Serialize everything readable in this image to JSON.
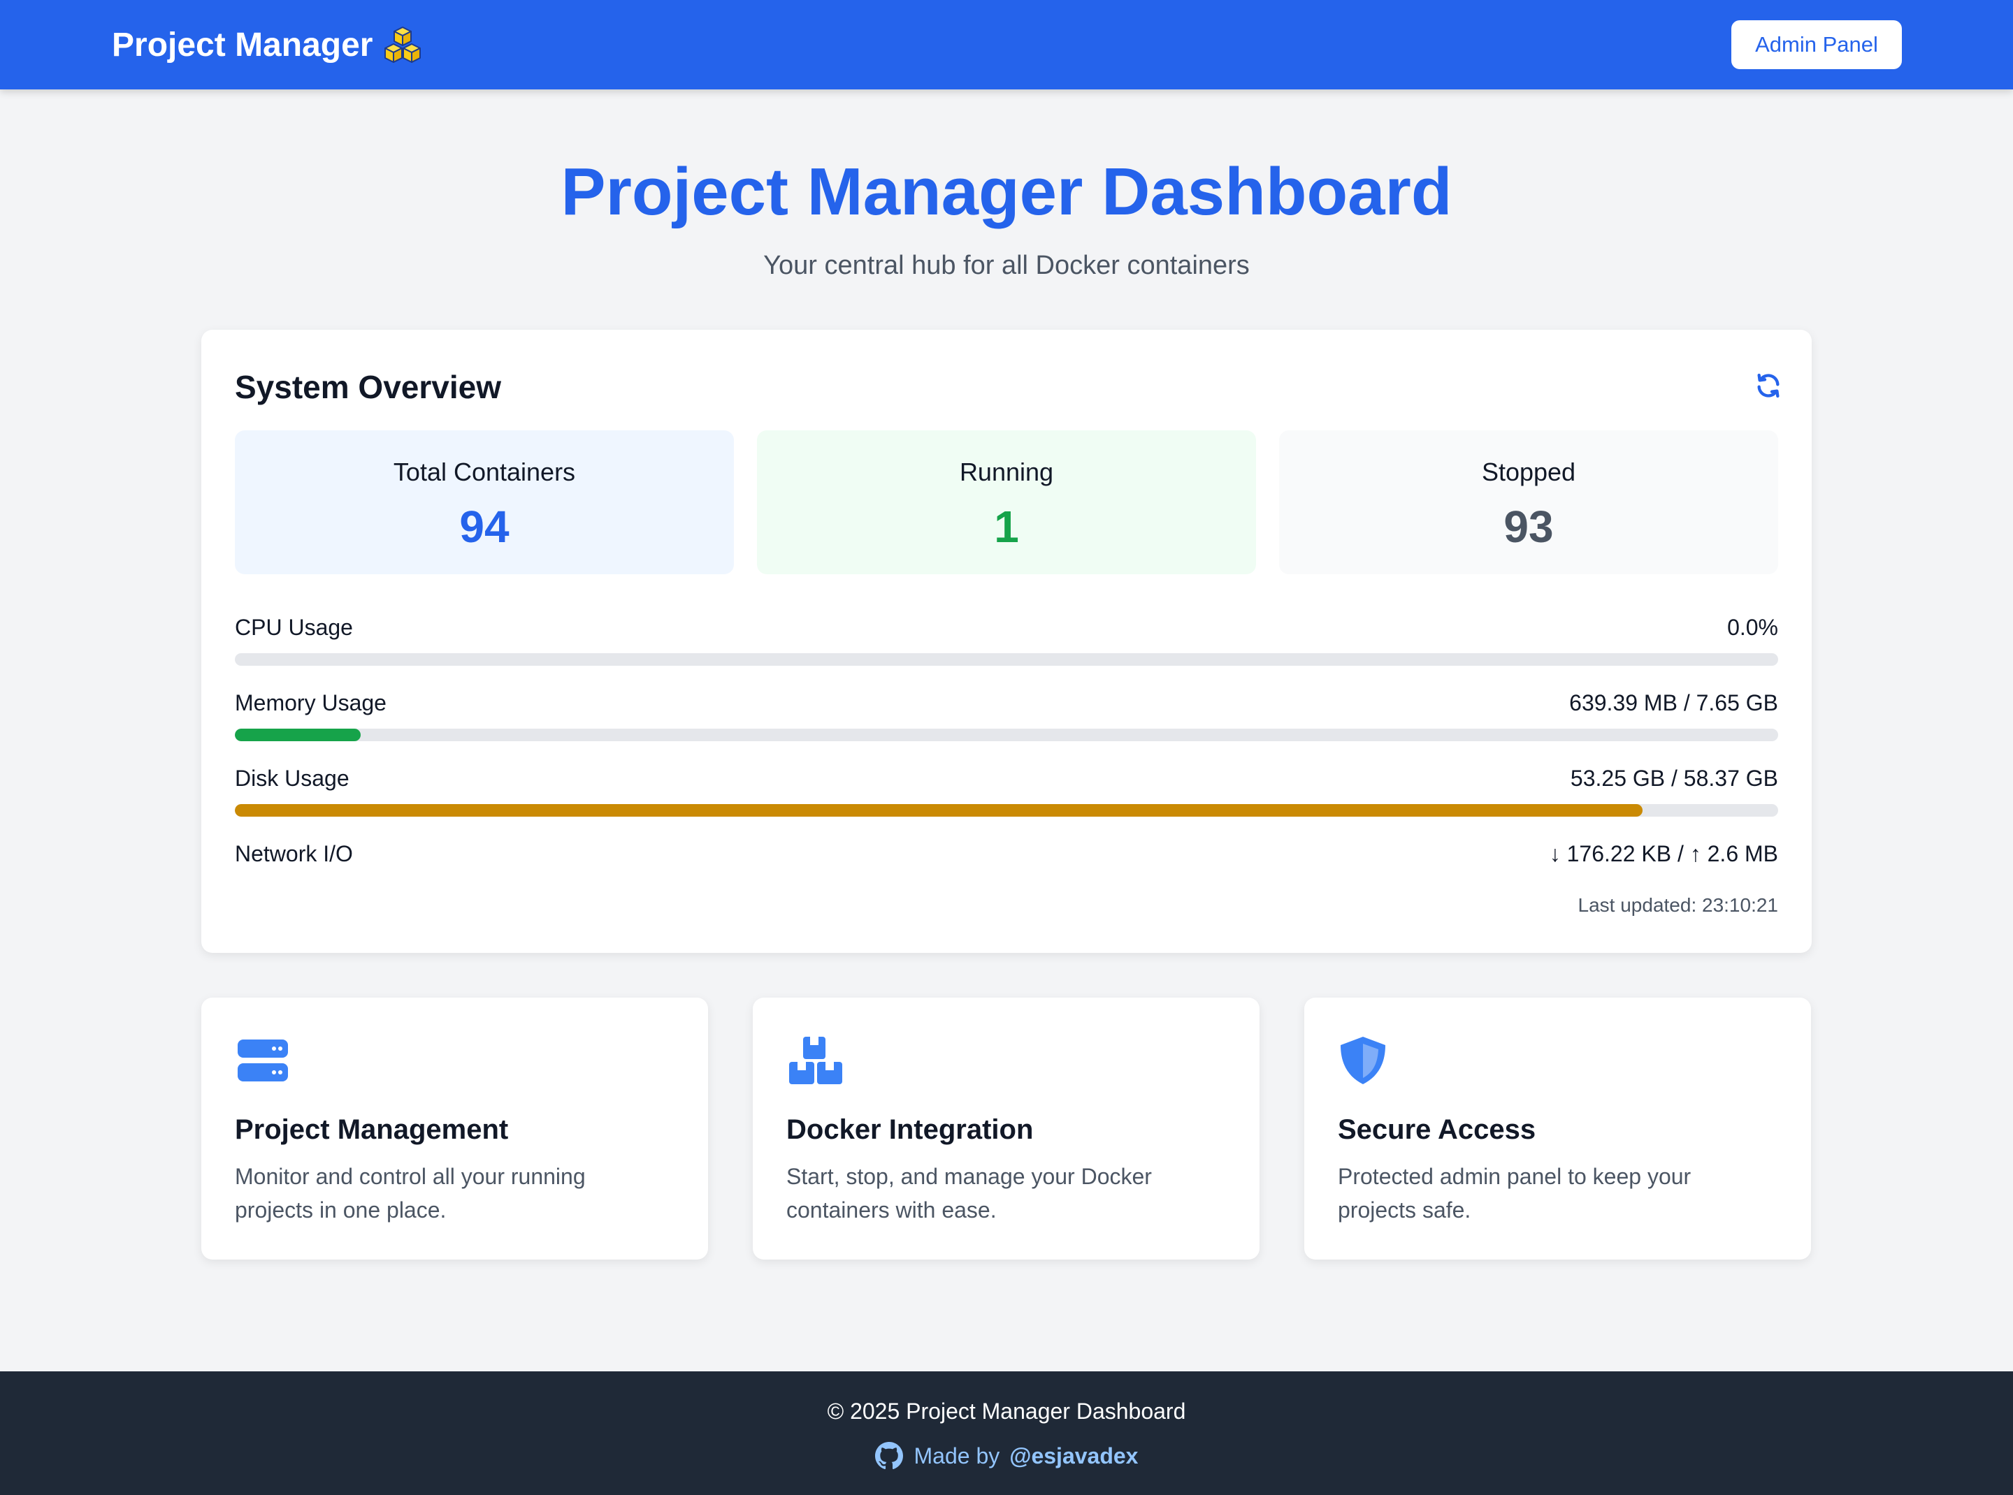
{
  "navbar": {
    "brand": "Project Manager",
    "brand_icon": "cubes-icon",
    "admin_button": "Admin Panel"
  },
  "hero": {
    "title": "Project Manager Dashboard",
    "subtitle": "Your central hub for all Docker containers"
  },
  "overview": {
    "title": "System Overview",
    "refresh_icon": "refresh-icon",
    "stats": [
      {
        "label": "Total Containers",
        "value": "94",
        "color": "#2563eb"
      },
      {
        "label": "Running",
        "value": "1",
        "color": "#16a34a"
      },
      {
        "label": "Stopped",
        "value": "93",
        "color": "#4b5563"
      }
    ],
    "metrics": [
      {
        "label": "CPU Usage",
        "value": "0.0%",
        "fraction": 0.0,
        "color": "#16a34a"
      },
      {
        "label": "Memory Usage",
        "value": "639.39 MB / 7.65 GB",
        "fraction": 0.0816,
        "color": "#16a34a"
      },
      {
        "label": "Disk Usage",
        "value": "53.25 GB / 58.37 GB",
        "fraction": 0.9123,
        "color": "#ca8a04"
      },
      {
        "label": "Network I/O",
        "value": "↓ 176.22 KB / ↑ 2.6 MB"
      }
    ],
    "last_updated": "Last updated: 23:10:21"
  },
  "features": [
    {
      "icon": "server-icon",
      "title": "Project Management",
      "description": "Monitor and control all your running projects in one place."
    },
    {
      "icon": "boxes-icon",
      "title": "Docker Integration",
      "description": "Start, stop, and manage your Docker containers with ease."
    },
    {
      "icon": "shield-icon",
      "title": "Secure Access",
      "description": "Protected admin panel to keep your projects safe."
    }
  ],
  "footer": {
    "copyright": "© 2025 Project Manager Dashboard",
    "made_by": "Made by",
    "handle": "@esjavadex",
    "icon": "github-icon"
  },
  "colors": {
    "primary": "#2563eb",
    "success": "#16a34a",
    "warning": "#ca8a04",
    "footer_bg": "#1f2937"
  }
}
